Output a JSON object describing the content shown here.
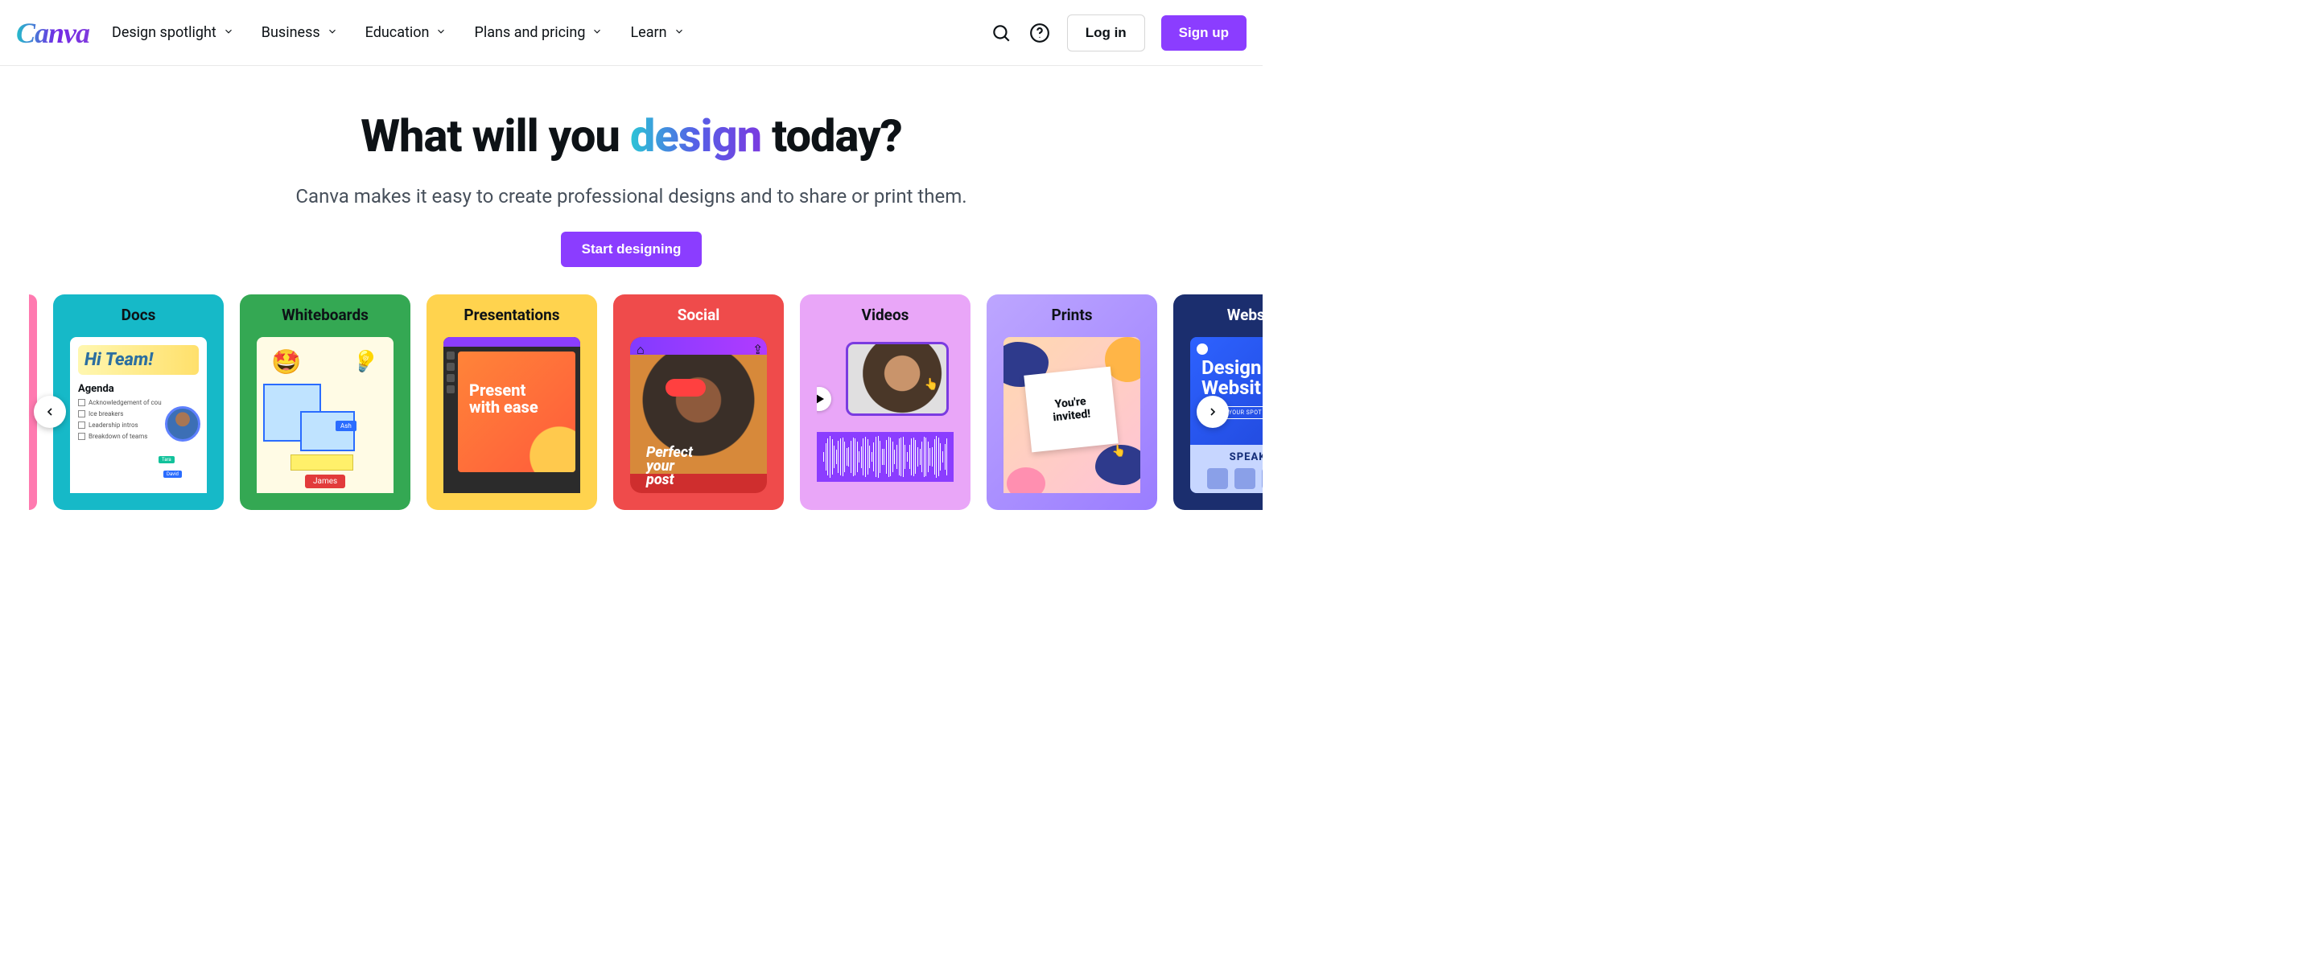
{
  "logo": "Canva",
  "nav": {
    "design_spotlight": "Design spotlight",
    "business": "Business",
    "education": "Education",
    "plans": "Plans and pricing",
    "learn": "Learn"
  },
  "actions": {
    "login": "Log in",
    "signup": "Sign up"
  },
  "hero": {
    "h1_pre": "What will you ",
    "h1_grad": "design",
    "h1_post": " today?",
    "sub": "Canva makes it easy to create professional designs and to share or print them.",
    "cta": "Start designing"
  },
  "cards": {
    "docs": {
      "title": "Docs",
      "hi": "Hi Team!",
      "agenda": "Agenda",
      "items": [
        "Acknowledgement of cou",
        "Ice breakers",
        "Leadership intros",
        "Breakdown of teams"
      ],
      "tag_a": "Tara",
      "tag_b": "David"
    },
    "whiteboards": {
      "title": "Whiteboards",
      "ash": "Ash",
      "james": "James"
    },
    "presentations": {
      "title": "Presentations",
      "slide_l1": "Present",
      "slide_l2": "with ease"
    },
    "social": {
      "title": "Social",
      "l1": "Perfect",
      "l2": "your",
      "l3": "post"
    },
    "videos": {
      "title": "Videos"
    },
    "prints": {
      "title": "Prints",
      "card_l1": "You're",
      "card_l2": "invited!"
    },
    "websites": {
      "title": "Websites",
      "h_l1": "Design",
      "h_l2": "Websit",
      "pill": "BOOK YOUR SPOT",
      "speakers": "SPEAKERS"
    }
  }
}
